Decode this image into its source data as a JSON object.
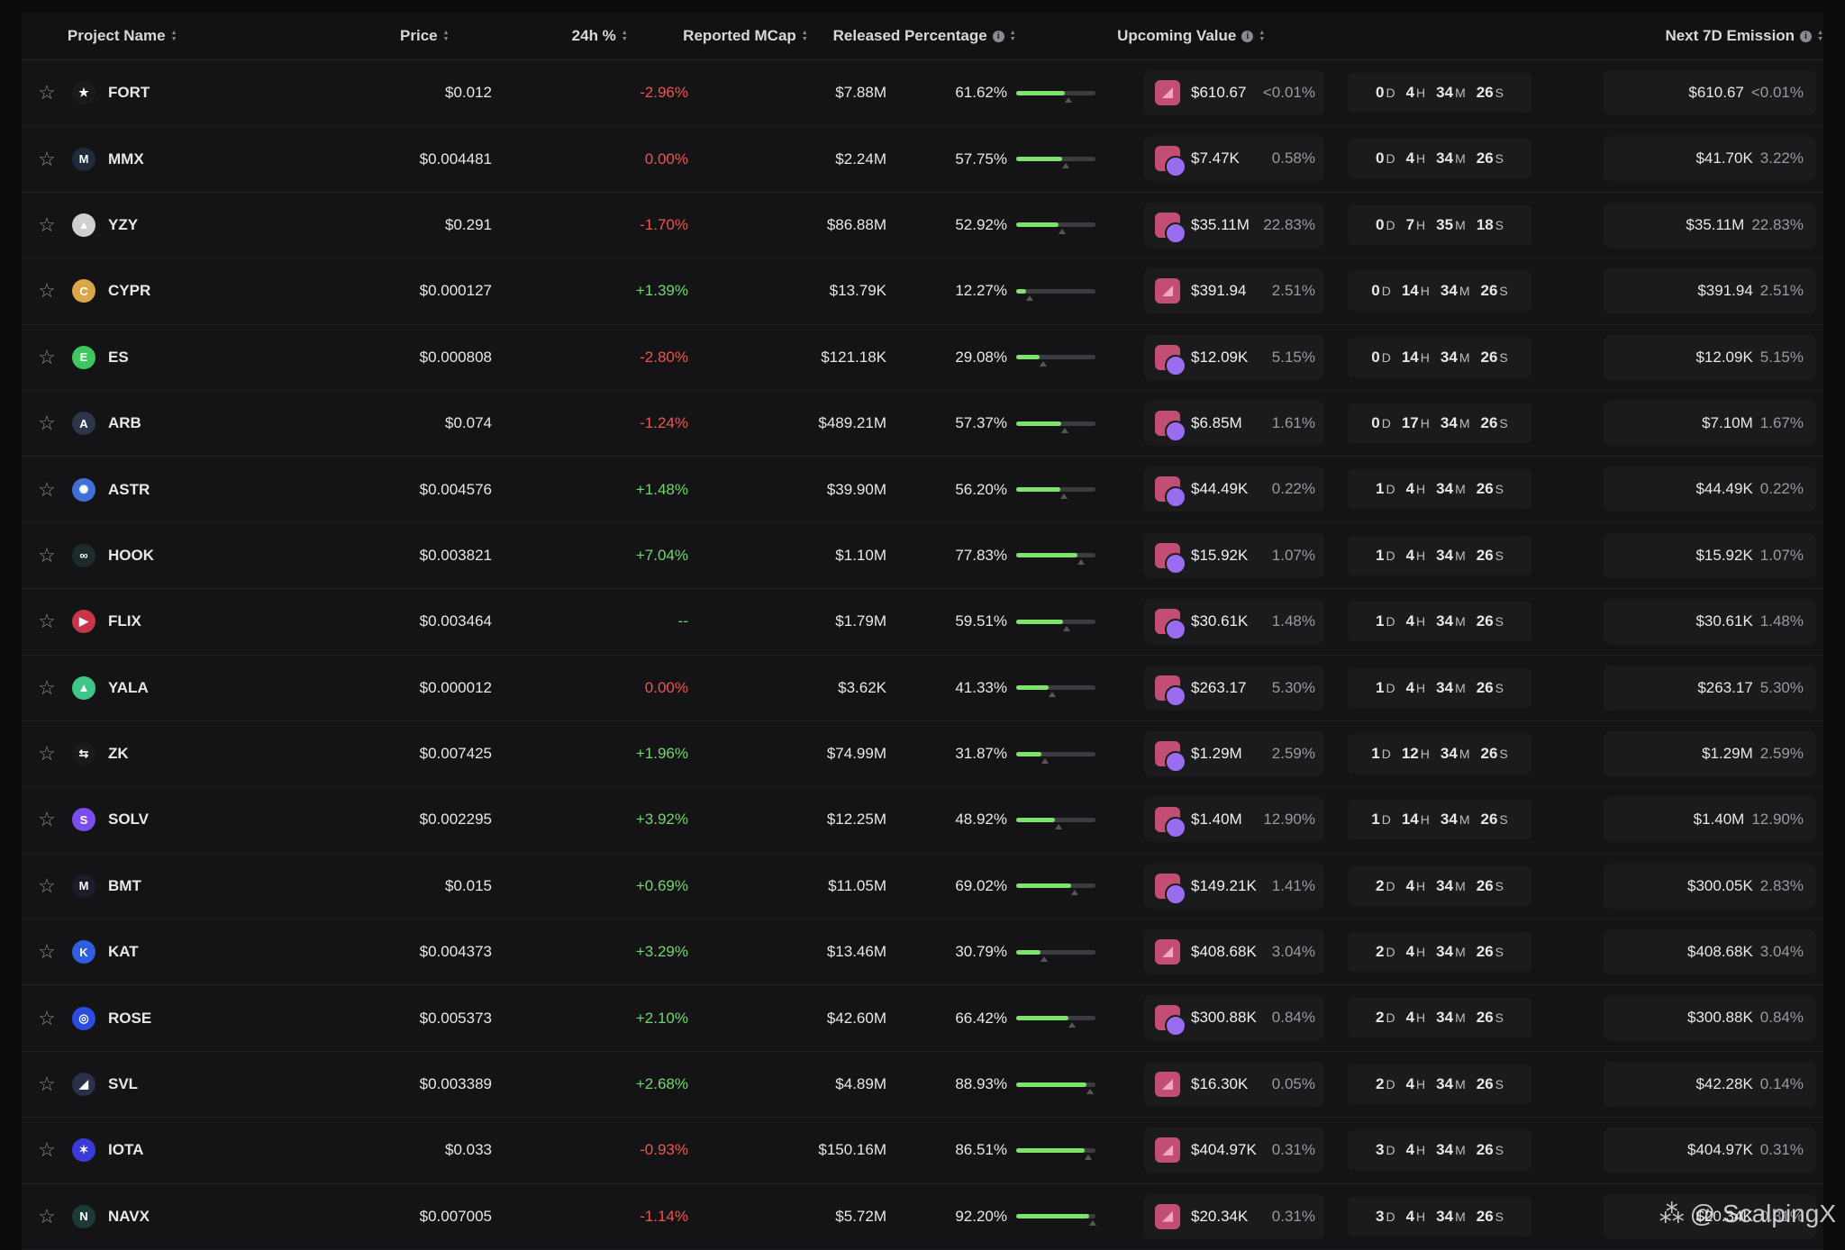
{
  "header": {
    "project_name": "Project Name",
    "price": "Price",
    "change_24h": "24h %",
    "reported_mcap": "Reported MCap",
    "released_percentage": "Released Percentage",
    "upcoming_value": "Upcoming Value",
    "next_7d_emission": "Next 7D Emission"
  },
  "colors": {
    "positive": "#70d86a",
    "negative": "#ef5350",
    "bar_fill": "#7ee36d",
    "background": "#0b0b0d"
  },
  "rows": [
    {
      "name": "FORT",
      "price": "$0.012",
      "change": "-2.96%",
      "dir": "neg",
      "mcap": "$7.88M",
      "released": "61.62%",
      "released_frac": 0.6162,
      "upcoming": "$610.67",
      "upcoming_pct": "<0.01%",
      "icon": "single-unlock-icon",
      "d": "0",
      "h": "4",
      "m": "34",
      "s": "26",
      "emission": "$610.67",
      "emission_pct": "<0.01%",
      "logo_color": "#1a1a1a",
      "logo_glyph": "★"
    },
    {
      "name": "MMX",
      "price": "$0.004481",
      "change": "0.00%",
      "dir": "neg",
      "mcap": "$2.24M",
      "released": "57.75%",
      "released_frac": 0.5775,
      "upcoming": "$7.47K",
      "upcoming_pct": "0.58%",
      "icon": "multi-unlock-icon",
      "d": "0",
      "h": "4",
      "m": "34",
      "s": "26",
      "emission": "$41.70K",
      "emission_pct": "3.22%",
      "logo_color": "#1f2a3a",
      "logo_glyph": "M"
    },
    {
      "name": "YZY",
      "price": "$0.291",
      "change": "-1.70%",
      "dir": "neg",
      "mcap": "$86.88M",
      "released": "52.92%",
      "released_frac": 0.5292,
      "upcoming": "$35.11M",
      "upcoming_pct": "22.83%",
      "icon": "multi-unlock-icon",
      "d": "0",
      "h": "7",
      "m": "35",
      "s": "18",
      "emission": "$35.11M",
      "emission_pct": "22.83%",
      "logo_color": "#cfcfcf",
      "logo_glyph": "▲"
    },
    {
      "name": "CYPR",
      "price": "$0.000127",
      "change": "+1.39%",
      "dir": "pos",
      "mcap": "$13.79K",
      "released": "12.27%",
      "released_frac": 0.1227,
      "upcoming": "$391.94",
      "upcoming_pct": "2.51%",
      "icon": "single-unlock-icon",
      "d": "0",
      "h": "14",
      "m": "34",
      "s": "26",
      "emission": "$391.94",
      "emission_pct": "2.51%",
      "logo_color": "#d9a74a",
      "logo_glyph": "C"
    },
    {
      "name": "ES",
      "price": "$0.000808",
      "change": "-2.80%",
      "dir": "neg",
      "mcap": "$121.18K",
      "released": "29.08%",
      "released_frac": 0.2908,
      "upcoming": "$12.09K",
      "upcoming_pct": "5.15%",
      "icon": "multi-unlock-icon",
      "d": "0",
      "h": "14",
      "m": "34",
      "s": "26",
      "emission": "$12.09K",
      "emission_pct": "5.15%",
      "logo_color": "#3fc75f",
      "logo_glyph": "E"
    },
    {
      "name": "ARB",
      "price": "$0.074",
      "change": "-1.24%",
      "dir": "neg",
      "mcap": "$489.21M",
      "released": "57.37%",
      "released_frac": 0.5737,
      "upcoming": "$6.85M",
      "upcoming_pct": "1.61%",
      "icon": "multi-unlock-icon",
      "d": "0",
      "h": "17",
      "m": "34",
      "s": "26",
      "emission": "$7.10M",
      "emission_pct": "1.67%",
      "logo_color": "#2d374b",
      "logo_glyph": "A"
    },
    {
      "name": "ASTR",
      "price": "$0.004576",
      "change": "+1.48%",
      "dir": "pos",
      "mcap": "$39.90M",
      "released": "56.20%",
      "released_frac": 0.562,
      "upcoming": "$44.49K",
      "upcoming_pct": "0.22%",
      "icon": "multi-unlock-icon",
      "d": "1",
      "h": "4",
      "m": "34",
      "s": "26",
      "emission": "$44.49K",
      "emission_pct": "0.22%",
      "logo_color": "#3f6fd8",
      "logo_glyph": "✺"
    },
    {
      "name": "HOOK",
      "price": "$0.003821",
      "change": "+7.04%",
      "dir": "pos",
      "mcap": "$1.10M",
      "released": "77.83%",
      "released_frac": 0.7783,
      "upcoming": "$15.92K",
      "upcoming_pct": "1.07%",
      "icon": "multi-unlock-icon",
      "d": "1",
      "h": "4",
      "m": "34",
      "s": "26",
      "emission": "$15.92K",
      "emission_pct": "1.07%",
      "logo_color": "#1d2b2b",
      "logo_glyph": "∞"
    },
    {
      "name": "FLIX",
      "price": "$0.003464",
      "change": "--",
      "dir": "pos",
      "mcap": "$1.79M",
      "released": "59.51%",
      "released_frac": 0.5951,
      "upcoming": "$30.61K",
      "upcoming_pct": "1.48%",
      "icon": "multi-unlock-icon",
      "d": "1",
      "h": "4",
      "m": "34",
      "s": "26",
      "emission": "$30.61K",
      "emission_pct": "1.48%",
      "logo_color": "#c8344a",
      "logo_glyph": "▶"
    },
    {
      "name": "YALA",
      "price": "$0.000012",
      "change": "0.00%",
      "dir": "neg",
      "mcap": "$3.62K",
      "released": "41.33%",
      "released_frac": 0.4133,
      "upcoming": "$263.17",
      "upcoming_pct": "5.30%",
      "icon": "multi-unlock-icon",
      "d": "1",
      "h": "4",
      "m": "34",
      "s": "26",
      "emission": "$263.17",
      "emission_pct": "5.30%",
      "logo_color": "#3fc78a",
      "logo_glyph": "▲"
    },
    {
      "name": "ZK",
      "price": "$0.007425",
      "change": "+1.96%",
      "dir": "pos",
      "mcap": "$74.99M",
      "released": "31.87%",
      "released_frac": 0.3187,
      "upcoming": "$1.29M",
      "upcoming_pct": "2.59%",
      "icon": "multi-unlock-icon",
      "d": "1",
      "h": "12",
      "m": "34",
      "s": "26",
      "emission": "$1.29M",
      "emission_pct": "2.59%",
      "logo_color": "#1a1a1a",
      "logo_glyph": "⇆"
    },
    {
      "name": "SOLV",
      "price": "$0.002295",
      "change": "+3.92%",
      "dir": "pos",
      "mcap": "$12.25M",
      "released": "48.92%",
      "released_frac": 0.4892,
      "upcoming": "$1.40M",
      "upcoming_pct": "12.90%",
      "icon": "multi-unlock-icon",
      "d": "1",
      "h": "14",
      "m": "34",
      "s": "26",
      "emission": "$1.40M",
      "emission_pct": "12.90%",
      "logo_color": "#7b4df0",
      "logo_glyph": "S"
    },
    {
      "name": "BMT",
      "price": "$0.015",
      "change": "+0.69%",
      "dir": "pos",
      "mcap": "$11.05M",
      "released": "69.02%",
      "released_frac": 0.6902,
      "upcoming": "$149.21K",
      "upcoming_pct": "1.41%",
      "icon": "multi-unlock-icon",
      "d": "2",
      "h": "4",
      "m": "34",
      "s": "26",
      "emission": "$300.05K",
      "emission_pct": "2.83%",
      "logo_color": "#1c1c2a",
      "logo_glyph": "M"
    },
    {
      "name": "KAT",
      "price": "$0.004373",
      "change": "+3.29%",
      "dir": "pos",
      "mcap": "$13.46M",
      "released": "30.79%",
      "released_frac": 0.3079,
      "upcoming": "$408.68K",
      "upcoming_pct": "3.04%",
      "icon": "single-unlock-icon",
      "d": "2",
      "h": "4",
      "m": "34",
      "s": "26",
      "emission": "$408.68K",
      "emission_pct": "3.04%",
      "logo_color": "#2f5fe0",
      "logo_glyph": "K"
    },
    {
      "name": "ROSE",
      "price": "$0.005373",
      "change": "+2.10%",
      "dir": "pos",
      "mcap": "$42.60M",
      "released": "66.42%",
      "released_frac": 0.6642,
      "upcoming": "$300.88K",
      "upcoming_pct": "0.84%",
      "icon": "multi-unlock-icon",
      "d": "2",
      "h": "4",
      "m": "34",
      "s": "26",
      "emission": "$300.88K",
      "emission_pct": "0.84%",
      "logo_color": "#2a4ce0",
      "logo_glyph": "◎"
    },
    {
      "name": "SVL",
      "price": "$0.003389",
      "change": "+2.68%",
      "dir": "pos",
      "mcap": "$4.89M",
      "released": "88.93%",
      "released_frac": 0.8893,
      "upcoming": "$16.30K",
      "upcoming_pct": "0.05%",
      "icon": "single-unlock-icon",
      "d": "2",
      "h": "4",
      "m": "34",
      "s": "26",
      "emission": "$42.28K",
      "emission_pct": "0.14%",
      "logo_color": "#2a2f4a",
      "logo_glyph": "◢"
    },
    {
      "name": "IOTA",
      "price": "$0.033",
      "change": "-0.93%",
      "dir": "neg",
      "mcap": "$150.16M",
      "released": "86.51%",
      "released_frac": 0.8651,
      "upcoming": "$404.97K",
      "upcoming_pct": "0.31%",
      "icon": "single-unlock-icon",
      "d": "3",
      "h": "4",
      "m": "34",
      "s": "26",
      "emission": "$404.97K",
      "emission_pct": "0.31%",
      "logo_color": "#3a3ad8",
      "logo_glyph": "✶"
    },
    {
      "name": "NAVX",
      "price": "$0.007005",
      "change": "-1.14%",
      "dir": "neg",
      "mcap": "$5.72M",
      "released": "92.20%",
      "released_frac": 0.922,
      "upcoming": "$20.34K",
      "upcoming_pct": "0.31%",
      "icon": "single-unlock-icon",
      "d": "3",
      "h": "4",
      "m": "34",
      "s": "26",
      "emission": "$20.34K",
      "emission_pct": "0.31%",
      "logo_color": "#1e3a36",
      "logo_glyph": "N"
    }
  ],
  "units": {
    "d": "D",
    "h": "H",
    "m": "M",
    "s": "S"
  },
  "watermark": "@ ScalpingX"
}
